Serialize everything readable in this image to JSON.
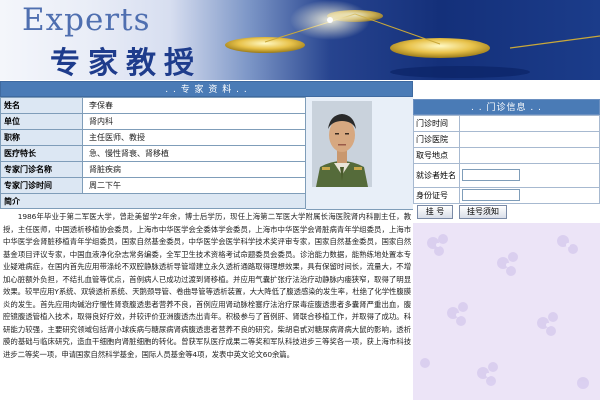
{
  "banner": {
    "title_en": "Experts",
    "title_cn": "专家教授"
  },
  "profile": {
    "header": ". . 专 家 资 料 . .",
    "rows": [
      {
        "label": "姓名",
        "value": "李保春"
      },
      {
        "label": "单位",
        "value": "肾内科"
      },
      {
        "label": "职称",
        "value": "主任医师、教授"
      },
      {
        "label": "医疗特长",
        "value": "急、慢性肾衰、肾移植"
      },
      {
        "label": "专家门诊名称",
        "value": "肾脏疾病"
      },
      {
        "label": "专家门诊时间",
        "value": "周二下午"
      }
    ],
    "intro_label": "简介",
    "intro_text": "1986年毕业于第二军医大学，曾赴美留学2年余，博士后学历，现任上海第二军医大学附属长海医院肾内科副主任，教授，主任医师，中国透析移植协会委员，上海市中华医学会全委体学会委员，上海市中华医学会肾脏病青年学组委员，上海市中华医学会肾脏移植青年学组委员，国家自然基金委员，中华医学会医学科学技术奖评审专家，国家自然基金委员，国家自然基金项目评议专家，中国血液净化杂志常务编委，全军卫生技术资格考试命题委员会委员。诊治能力数据，能熟练地处置本专业疑难病症，在国内首先应用带涤纶不双腔静脉透析导管增建立永久透析通路取得理想效果，具有保留时间长，流量大，不增加心脏额外负担，不结扎血管等优点，首例病人已成功过渡到肾移植。并应用气囊扩张疗法治疗动静脉内瘘狭窄，取得了明显效果。较早应用Y系统、双袋透析系统、天鹅颈导管、卷曲导管等透析装置，大大降低了腹透感染的发生率，杜绝了化学性腹膜炎的发生。首先应用肉碱治疗慢性肾衰腹透患者营养不良，首例应用肾动脉栓塞疗法治疗尿毒症腹透患者多囊肾严重出血，腹腔镜腹透管植入技术，取得良好疗效，并较评价亚洲腹透杰出青年。积极参与了首例肝、肾联合移植工作，并取得了成功。科研能力较强，主要研究领域包括肾小球疾病与糖尿病肾病腹透患者营养不良的研究，柴胡皂甙对糖尿病肾病大鼠的影响，透析膜的基础与临床研究，造血干细胞向肾脏细胞的转化。曾获军队医疗成果二等奖和军队科技进步三等奖各一项，获上海市科技进步二等奖一项，申请国家自然科学基金，国际人员基金等4项，发表中英文论文60余篇。"
  },
  "clinic": {
    "header": ". . 门诊信息 . .",
    "rows": [
      {
        "label": "门诊时间",
        "value": ""
      },
      {
        "label": "门诊医院",
        "value": ""
      },
      {
        "label": "取号地点",
        "value": ""
      },
      {
        "label": "就诊者姓名",
        "value": "",
        "input": true
      },
      {
        "label": "身份证号",
        "value": "",
        "input": true
      }
    ],
    "btn_register": "挂 号",
    "btn_notice": "挂号须知"
  },
  "colors": {
    "header_blue": "#4a7bb6",
    "label_bg": "#dce7f3",
    "lavender": "#ece4f7"
  }
}
